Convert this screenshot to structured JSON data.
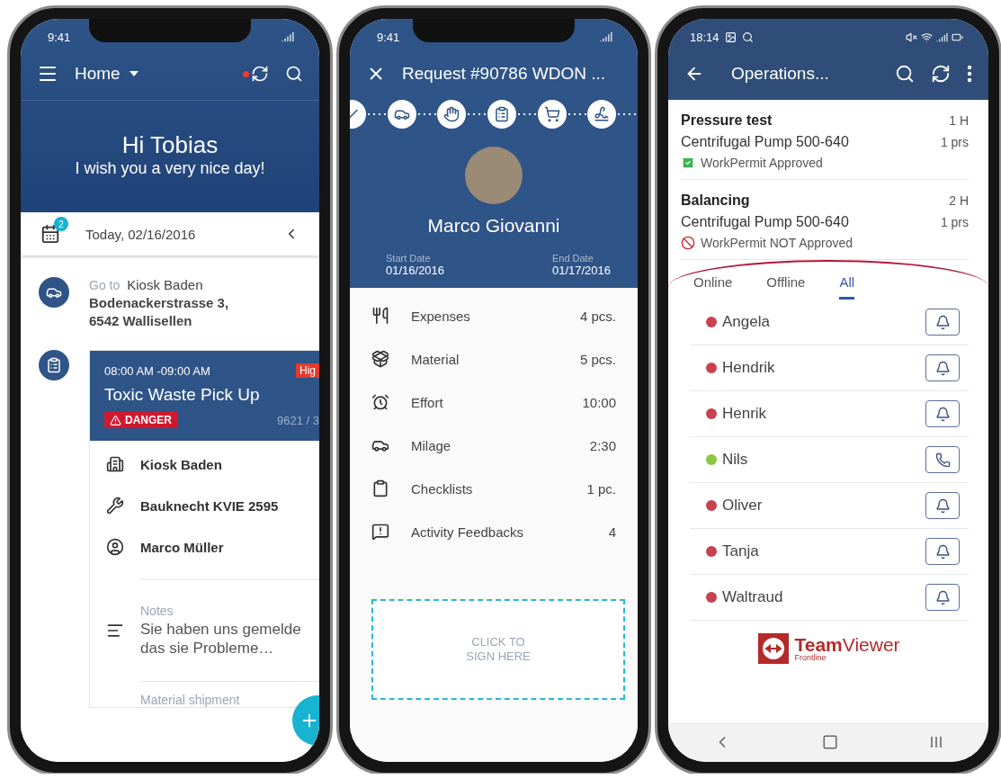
{
  "home_screen": {
    "status_time": "9:41",
    "app_bar": {
      "title": "Home",
      "sync_pending": true
    },
    "greeting": {
      "title": "Hi Tobias",
      "subtitle": "I wish you a very nice day!"
    },
    "date_bar": {
      "badge": "2",
      "date": "Today, 02/16/2016"
    },
    "route": {
      "prefix": "Go to",
      "place": "Kiosk Baden",
      "address_lines": [
        "Bodenackerstrasse 3,",
        "6542 Wallisellen"
      ]
    },
    "job": {
      "time": "08:00 AM -09:00 AM",
      "priority": "Hig",
      "title": "Toxic Waste Pick Up",
      "tag": "DANGER",
      "number": "9621 / 3",
      "details": [
        {
          "kind": "building",
          "text": "Kiosk Baden"
        },
        {
          "kind": "tool",
          "text": "Bauknecht KVIE 2595"
        },
        {
          "kind": "person",
          "text": "Marco Müller"
        }
      ],
      "notes": {
        "label": "Notes",
        "lines": [
          "Sie haben uns gemelde",
          "das sie Probleme…"
        ]
      },
      "shipment_label": "Material shipment"
    }
  },
  "request_screen": {
    "status_time": "9:41",
    "title": "Request #90786 WDON ...",
    "person": "Marco Giovanni",
    "start_date": {
      "label": "Start Date",
      "value": "01/16/2016"
    },
    "end_date": {
      "label": "End Date",
      "value": "01/17/2016"
    },
    "summary": [
      {
        "kind": "expenses",
        "label": "Expenses",
        "value": "4 pcs."
      },
      {
        "kind": "material",
        "label": "Material",
        "value": "5 pcs."
      },
      {
        "kind": "effort",
        "label": "Effort",
        "value": "10:00"
      },
      {
        "kind": "milage",
        "label": "Milage",
        "value": "2:30"
      },
      {
        "kind": "checklist",
        "label": "Checklists",
        "value": "1 pc."
      },
      {
        "kind": "feedback",
        "label": "Activity Feedbacks",
        "value": "4"
      }
    ],
    "signature_lines": [
      "CLICK TO",
      "SIGN HERE"
    ]
  },
  "operations_screen": {
    "status_time": "18:14",
    "title": "Operations...",
    "operations": [
      {
        "title": "Pressure test",
        "equipment": "Centrifugal Pump 500-640",
        "duration": "1 H",
        "people": "1 prs",
        "permit": {
          "approved": true,
          "text": "WorkPermit Approved"
        }
      },
      {
        "title": "Balancing",
        "equipment": "Centrifugal Pump 500-640",
        "duration": "2 H",
        "people": "1 prs",
        "permit": {
          "approved": false,
          "text": "WorkPermit NOT Approved"
        }
      }
    ],
    "assist": {
      "tabs": [
        {
          "label": "Online",
          "selected": false
        },
        {
          "label": "Offline",
          "selected": false
        },
        {
          "label": "All",
          "selected": true
        }
      ],
      "contacts": [
        {
          "name": "Angela",
          "color": "#c8414f",
          "kind": "bell"
        },
        {
          "name": "Hendrik",
          "color": "#c8414f",
          "kind": "bell"
        },
        {
          "name": "Henrik",
          "color": "#c8414f",
          "kind": "bell"
        },
        {
          "name": "Nils",
          "color": "#8cc63f",
          "kind": "call"
        },
        {
          "name": "Oliver",
          "color": "#c8414f",
          "kind": "bell"
        },
        {
          "name": "Tanja",
          "color": "#c8414f",
          "kind": "bell"
        },
        {
          "name": "Waltraud",
          "color": "#c8414f",
          "kind": "bell"
        }
      ],
      "logo": {
        "strong": "Team",
        "light": "Viewer",
        "sub": "Frontline"
      }
    }
  }
}
